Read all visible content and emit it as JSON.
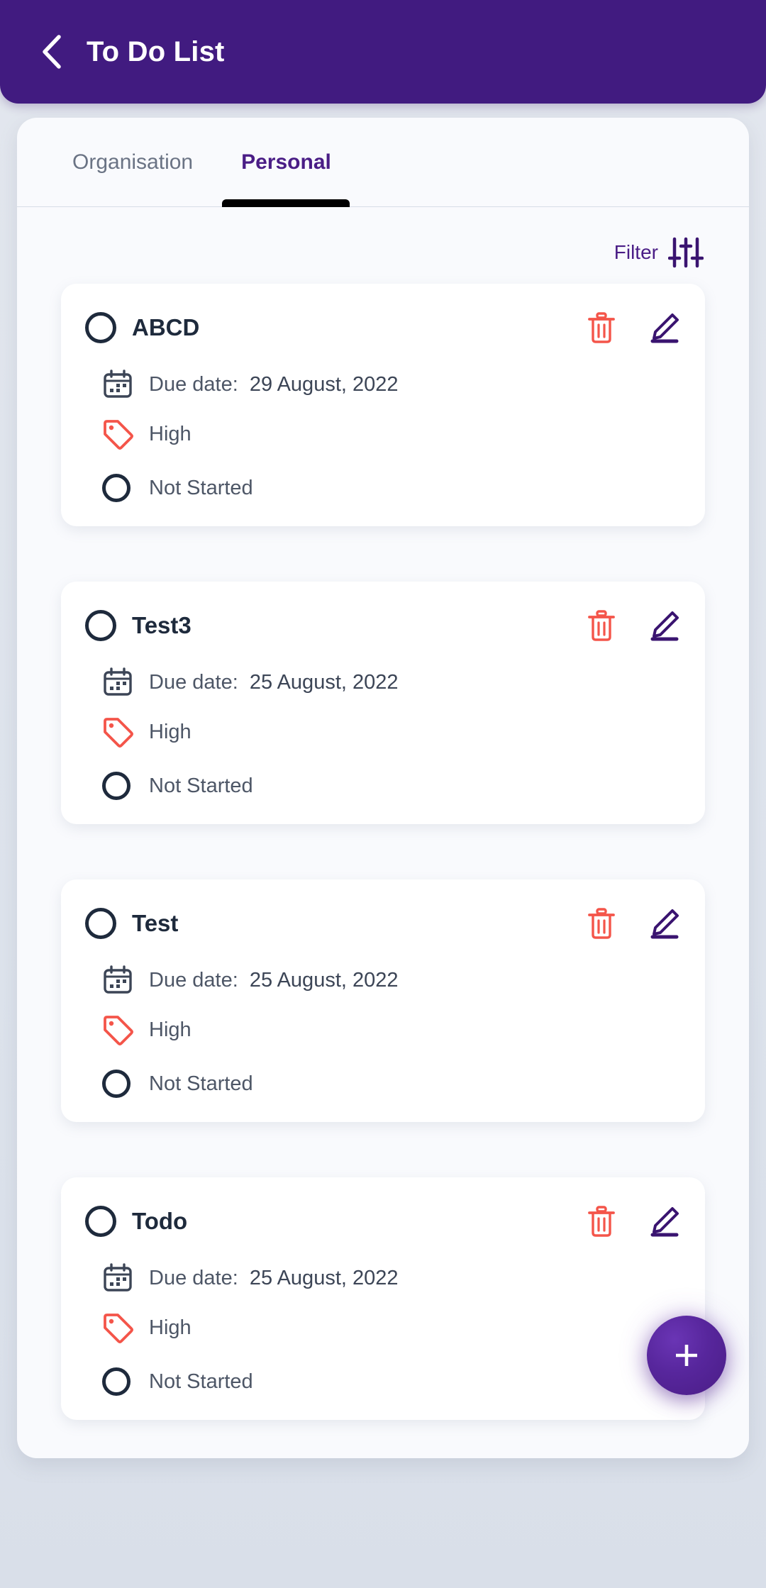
{
  "header": {
    "title": "To Do List",
    "back_icon": "chevron-left-icon",
    "background_color": "#411b80",
    "title_color": "#ffffff"
  },
  "tabs": [
    {
      "label": "Organisation",
      "active": false
    },
    {
      "label": "Personal",
      "active": true
    }
  ],
  "filter": {
    "label": "Filter",
    "icon": "sliders-icon",
    "color": "#4a1d86"
  },
  "colors": {
    "accent_purple": "#4a1d86",
    "danger_red": "#f4554a",
    "text_dark": "#1e2a3c",
    "text_muted": "#4d5666",
    "page_background": "#dde3ec",
    "card_background": "#ffffff"
  },
  "labels": {
    "due_date_prefix": "Due date:",
    "delete_icon": "trash-icon",
    "edit_icon": "pencil-icon",
    "calendar_icon": "calendar-icon",
    "tag_icon": "tag-icon",
    "checkbox_icon": "circle-checkbox-icon",
    "status_icon": "circle-status-icon"
  },
  "tasks": [
    {
      "title": "ABCD",
      "due_date": "29 August, 2022",
      "priority": "High",
      "status": "Not Started"
    },
    {
      "title": "Test3",
      "due_date": "25 August, 2022",
      "priority": "High",
      "status": "Not Started"
    },
    {
      "title": "Test",
      "due_date": "25 August, 2022",
      "priority": "High",
      "status": "Not Started"
    },
    {
      "title": "Todo",
      "due_date": "25 August, 2022",
      "priority": "High",
      "status": "Not Started"
    }
  ],
  "fab": {
    "icon": "plus-icon",
    "color": "#4a1d86"
  }
}
